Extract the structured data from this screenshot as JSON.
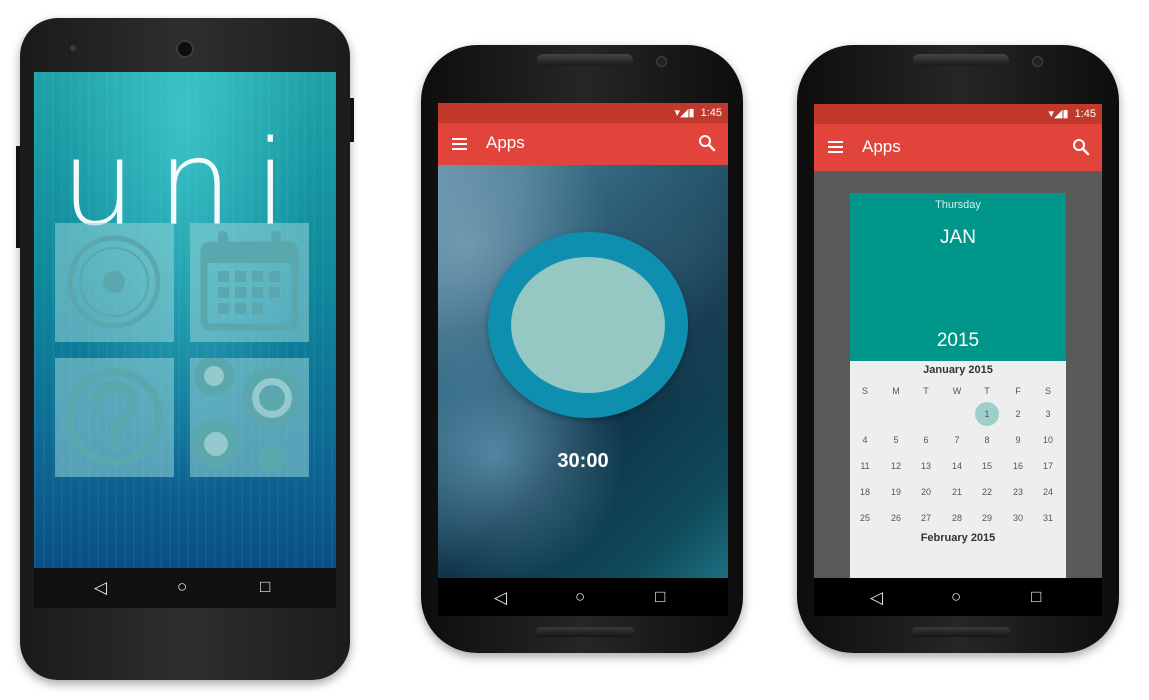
{
  "phone1": {
    "logo_text": "uni",
    "tiles": [
      {
        "name": "radio-tile",
        "icon": "radio-button-icon"
      },
      {
        "name": "calendar-tile",
        "icon": "calendar-icon"
      },
      {
        "name": "help-tile",
        "icon": "question-mark-icon"
      },
      {
        "name": "settings-tile",
        "icon": "gears-icon"
      }
    ]
  },
  "phone2": {
    "status_time": "1:45",
    "app_title": "Apps",
    "timer": "30:00",
    "colors": {
      "statusbar": "#c0392b",
      "appbar": "#e0443b",
      "ring": "#0f8fb0",
      "inner": "#95c8c3"
    }
  },
  "phone3": {
    "status_time": "1:45",
    "app_title": "Apps",
    "calendar": {
      "weekday": "Thursday",
      "month": "JAN",
      "year": "2015",
      "month_title": "January 2015",
      "next_month_title": "February 2015",
      "weekday_headers": [
        "S",
        "M",
        "T",
        "W",
        "T",
        "F",
        "S"
      ],
      "selected_day": "1",
      "days": [
        "1",
        "2",
        "3",
        "4",
        "5",
        "6",
        "7",
        "8",
        "9",
        "10",
        "11",
        "12",
        "13",
        "14",
        "15",
        "16",
        "17",
        "18",
        "19",
        "20",
        "21",
        "22",
        "23",
        "24",
        "25",
        "26",
        "27",
        "28",
        "29",
        "30",
        "31"
      ]
    },
    "colors": {
      "header": "#00968a",
      "selected": "#9fcfcb"
    }
  },
  "nav": {
    "back": "◁",
    "home": "○",
    "recents": "□"
  }
}
